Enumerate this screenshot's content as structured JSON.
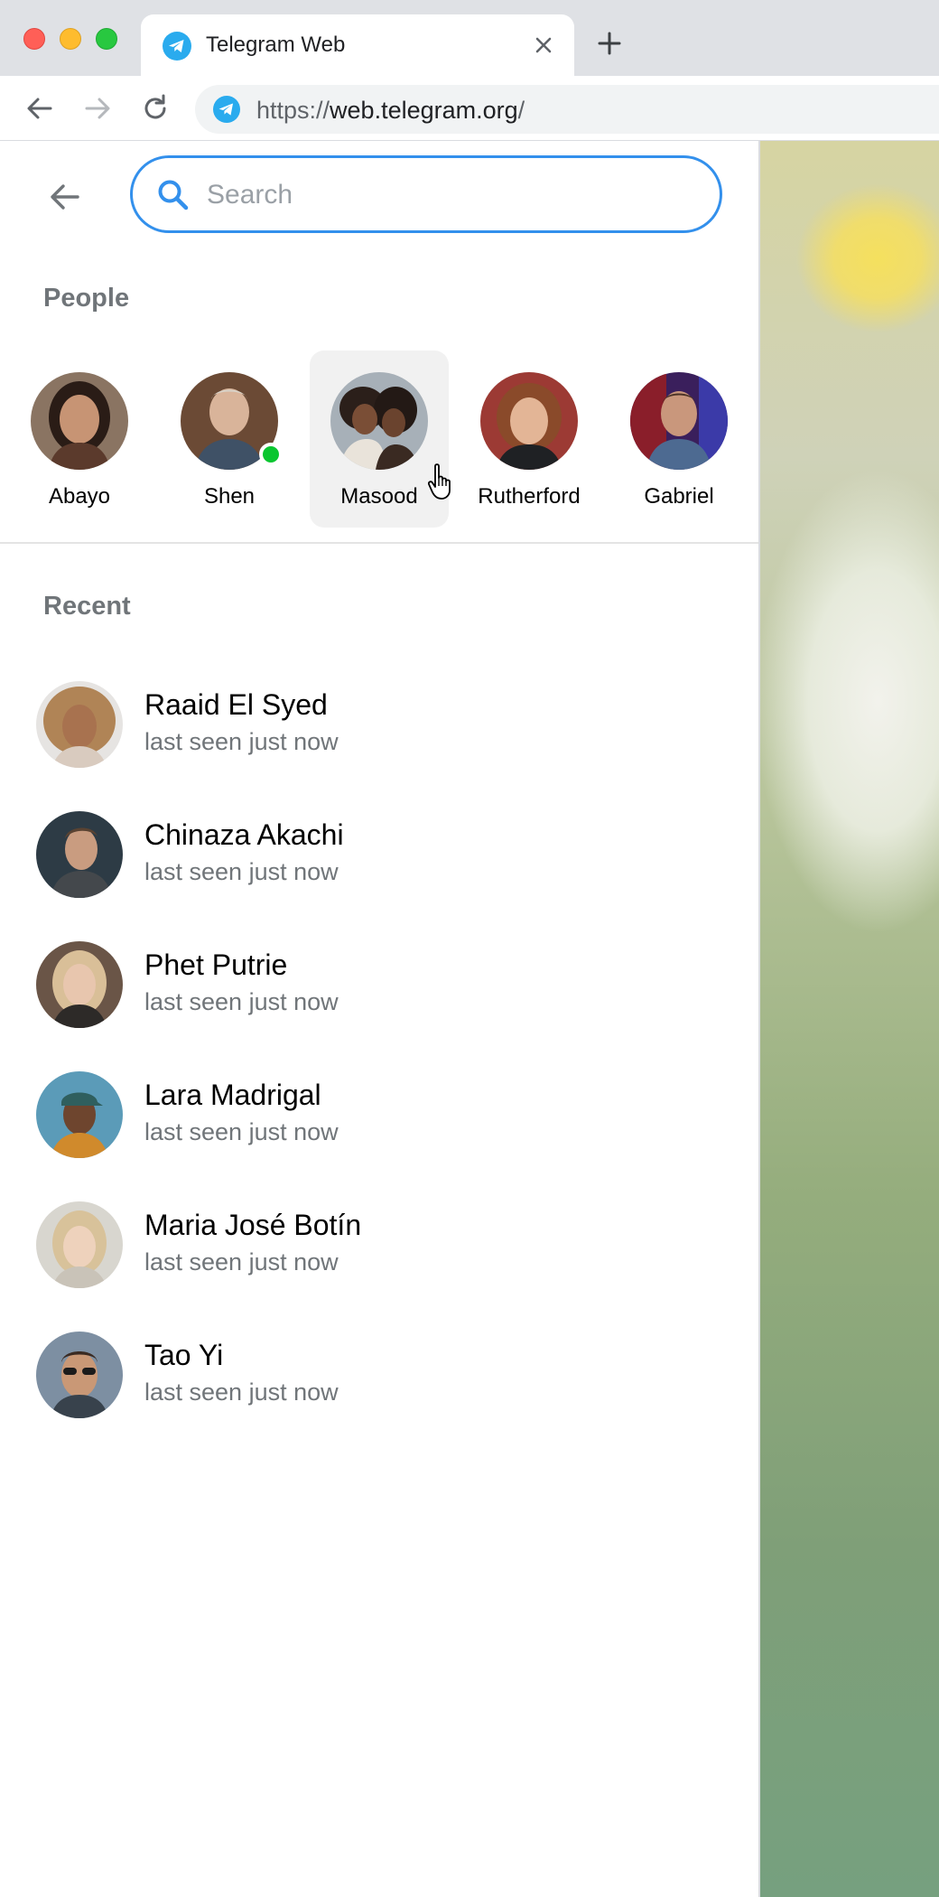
{
  "browser": {
    "tab_title": "Telegram Web",
    "url_protocol": "https://",
    "url_host": "web.telegram.org",
    "url_path": "/"
  },
  "search": {
    "placeholder": "Search",
    "value": ""
  },
  "people": {
    "title": "People",
    "items": [
      {
        "name": "Abayo",
        "online": false
      },
      {
        "name": "Shen",
        "online": true
      },
      {
        "name": "Masood",
        "online": false
      },
      {
        "name": "Rutherford",
        "online": false
      },
      {
        "name": "Gabriel",
        "online": false
      }
    ]
  },
  "recent": {
    "title": "Recent",
    "items": [
      {
        "name": "Raaid El Syed",
        "status": "last seen just now"
      },
      {
        "name": "Chinaza Akachi",
        "status": "last seen just now"
      },
      {
        "name": "Phet Putrie",
        "status": "last seen just now"
      },
      {
        "name": "Lara Madrigal",
        "status": "last seen just now"
      },
      {
        "name": "Maria José Botín",
        "status": "last seen just now"
      },
      {
        "name": "Tao Yi",
        "status": "last seen just now"
      }
    ]
  },
  "colors": {
    "accent": "#3390ec",
    "online": "#0ac630",
    "secondary_text": "#707579"
  }
}
